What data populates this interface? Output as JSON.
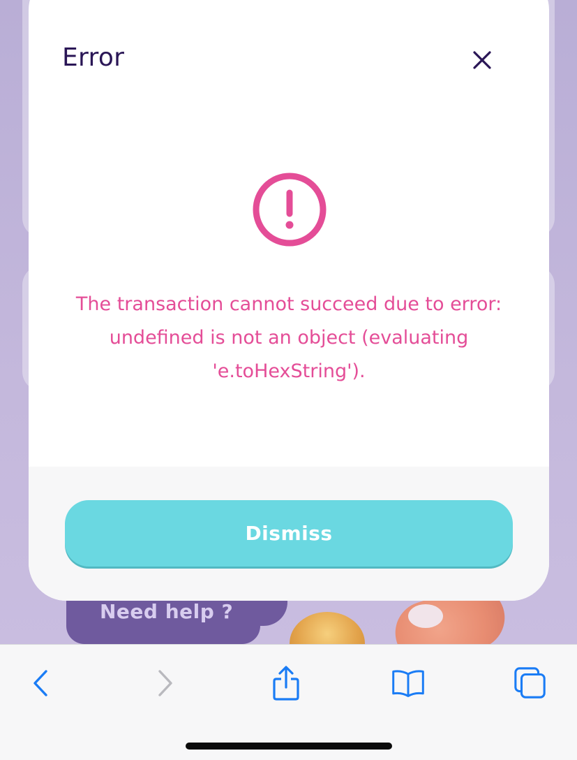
{
  "modal": {
    "title": "Error",
    "message": "The transaction cannot succeed due to error: undefined is not an object (evaluating 'e.toHexString').",
    "dismiss_label": "Dismiss",
    "close_icon": "close-icon",
    "alert_icon": "exclamation-circle-icon",
    "accent_color": "#e44d97",
    "button_color": "#6ad8e1"
  },
  "background": {
    "help_label": "Need help ?"
  },
  "toolbar": {
    "items": [
      "back-icon",
      "forward-icon",
      "share-icon",
      "bookmarks-icon",
      "tabs-icon"
    ],
    "accent_color": "#1a7cf5"
  }
}
